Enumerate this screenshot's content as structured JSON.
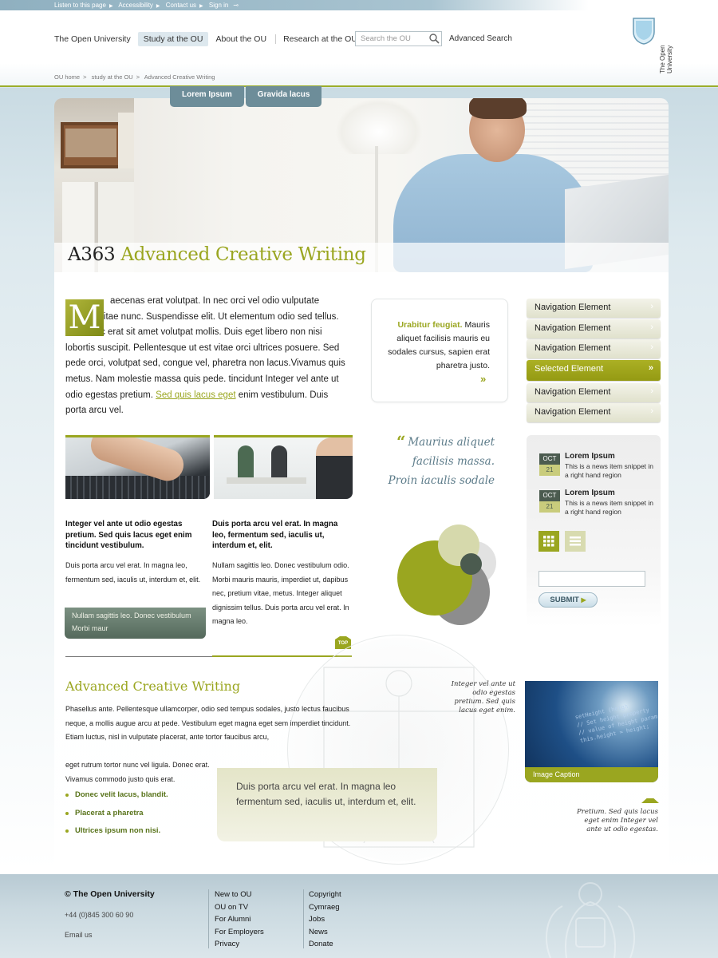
{
  "util_links": [
    "Listen to this page",
    "Accessibility",
    "Contact us",
    "Sign in"
  ],
  "topnav": {
    "items": [
      "The Open University",
      "Study at the OU",
      "About the OU",
      "Research at the OU"
    ],
    "active": "Study at the OU",
    "search_placeholder": "Search the OU",
    "advanced_search": "Advanced Search"
  },
  "logo_text": "The Open University",
  "breadcrumb": [
    "OU home",
    "study at the OU",
    "Advanced Creative Writing"
  ],
  "hero": {
    "tabs": [
      "Lorem Ipsum",
      "Gravida lacus"
    ],
    "title_code": "A363",
    "title_name": "Advanced Creative Writing"
  },
  "intro": {
    "dropcap": "M",
    "text_before_link": "aecenas erat volutpat. In nec orci vel odio vulputate sagittis. vitae nunc. Suspendisse  elit. Ut elementum odio sed tellus. Mauris ac erat sit amet  volutpat mollis. Duis eget libero non nisi lobortis suscipit. Pellentesque ut est vitae orci ultrices posuere. Sed pede orci, volutpat sed, congue vel, pharetra non lacus.Vivamus quis metus.  Nam molestie massa quis pede. tincidunt Integer vel ante ut odio egestas pretium. ",
    "link": "Sed quis lacus eget",
    "text_after_link": " enim  vestibulum. Duis porta arcu vel."
  },
  "callout": {
    "highlight": "Urabitur feugiat.",
    "text": " Mauris aliquet facilisis mauris eu sodales cursus, sapien erat pharetra justo.",
    "arrow": "»"
  },
  "quote": {
    "mark": "“",
    "text": "Maurius aliquet facilisis massa. Proin iaculis  sodale"
  },
  "nav": [
    {
      "label": "Navigation Element",
      "selected": false
    },
    {
      "label": "Navigation Element",
      "selected": false
    },
    {
      "label": "Navigation Element",
      "selected": false
    },
    {
      "label": "Selected Element",
      "selected": true
    },
    {
      "label": "Navigation Element",
      "selected": false
    },
    {
      "label": "Navigation Element",
      "selected": false
    }
  ],
  "news": [
    {
      "month": "OCT",
      "day": "21",
      "title": "Lorem Ipsum",
      "snippet": "This is a news item snippet in a right hand region"
    },
    {
      "month": "OCT",
      "day": "21",
      "title": "Lorem Ipsum",
      "snippet": "This is a news item snippet in a right hand region"
    }
  ],
  "form": {
    "submit": "SUBMIT"
  },
  "columns": [
    {
      "heading": "Integer vel ante ut odio egestas pretium. Sed quis lacus eget enim tincidunt vestibulum.",
      "paragraph": "Duis porta arcu vel erat. In magna leo, fermentum sed, iaculis ut, interdum et, elit.",
      "box": "Nullam sagittis leo. Donec vestibulum Morbi maur"
    },
    {
      "heading": "Duis porta arcu vel erat. In magna leo, fermentum sed, iaculis ut, interdum et, elit.",
      "paragraph": "Nullam sagittis leo. Donec vestibulum odio. Morbi mauris mauris, imperdiet ut, dapibus nec, pretium vitae, metus. Integer aliquet dignissim tellus.  Duis porta arcu vel erat. In magna leo."
    }
  ],
  "top_label": "TOP",
  "section": {
    "title": "Advanced Creative Writing",
    "para1": "Phasellus ante. Pellentesque ullamcorper, odio sed tempus sodales, justo lectus faucibus neque, a mollis augue arcu at pede. Vestibulum eget magna eget sem imperdiet tincidunt. Etiam luctus, nisl in vulputate placerat, ante tortor faucibus arcu,",
    "para2": "eget rutrum tortor nunc vel ligula. Donec erat. Vivamus commodo justo quis erat.",
    "side_note_top": "Integer vel ante ut odio egestas pretium. Sed quis lacus eget enim.",
    "side_note_bottom": "Pretium. Sed quis lacus eget enim Integer vel ante ut odio egestas.",
    "image_caption": "Image Caption",
    "bullets": [
      "Donec velit lacus, blandit.",
      "Placerat a pharetra",
      "Ultrices ipsum non nisi."
    ],
    "pull_quote": "Duis porta arcu vel erat. In magna leo fermentum sed, iaculis ut, interdum et, elit."
  },
  "footer": {
    "brand": "© The Open University",
    "phone": "+44 (0)845 300 60 90",
    "email": "Email us",
    "col1": [
      "New to OU",
      "OU on TV",
      "For Alumni",
      "For Employers",
      "Privacy"
    ],
    "col2": [
      "Copyright",
      "Cymraeg",
      "Jobs",
      "News",
      "Donate"
    ]
  },
  "colors": {
    "accent": "#9aa620",
    "nav_blue": "#6d8d99",
    "dark_green": "#4b5b4f"
  }
}
